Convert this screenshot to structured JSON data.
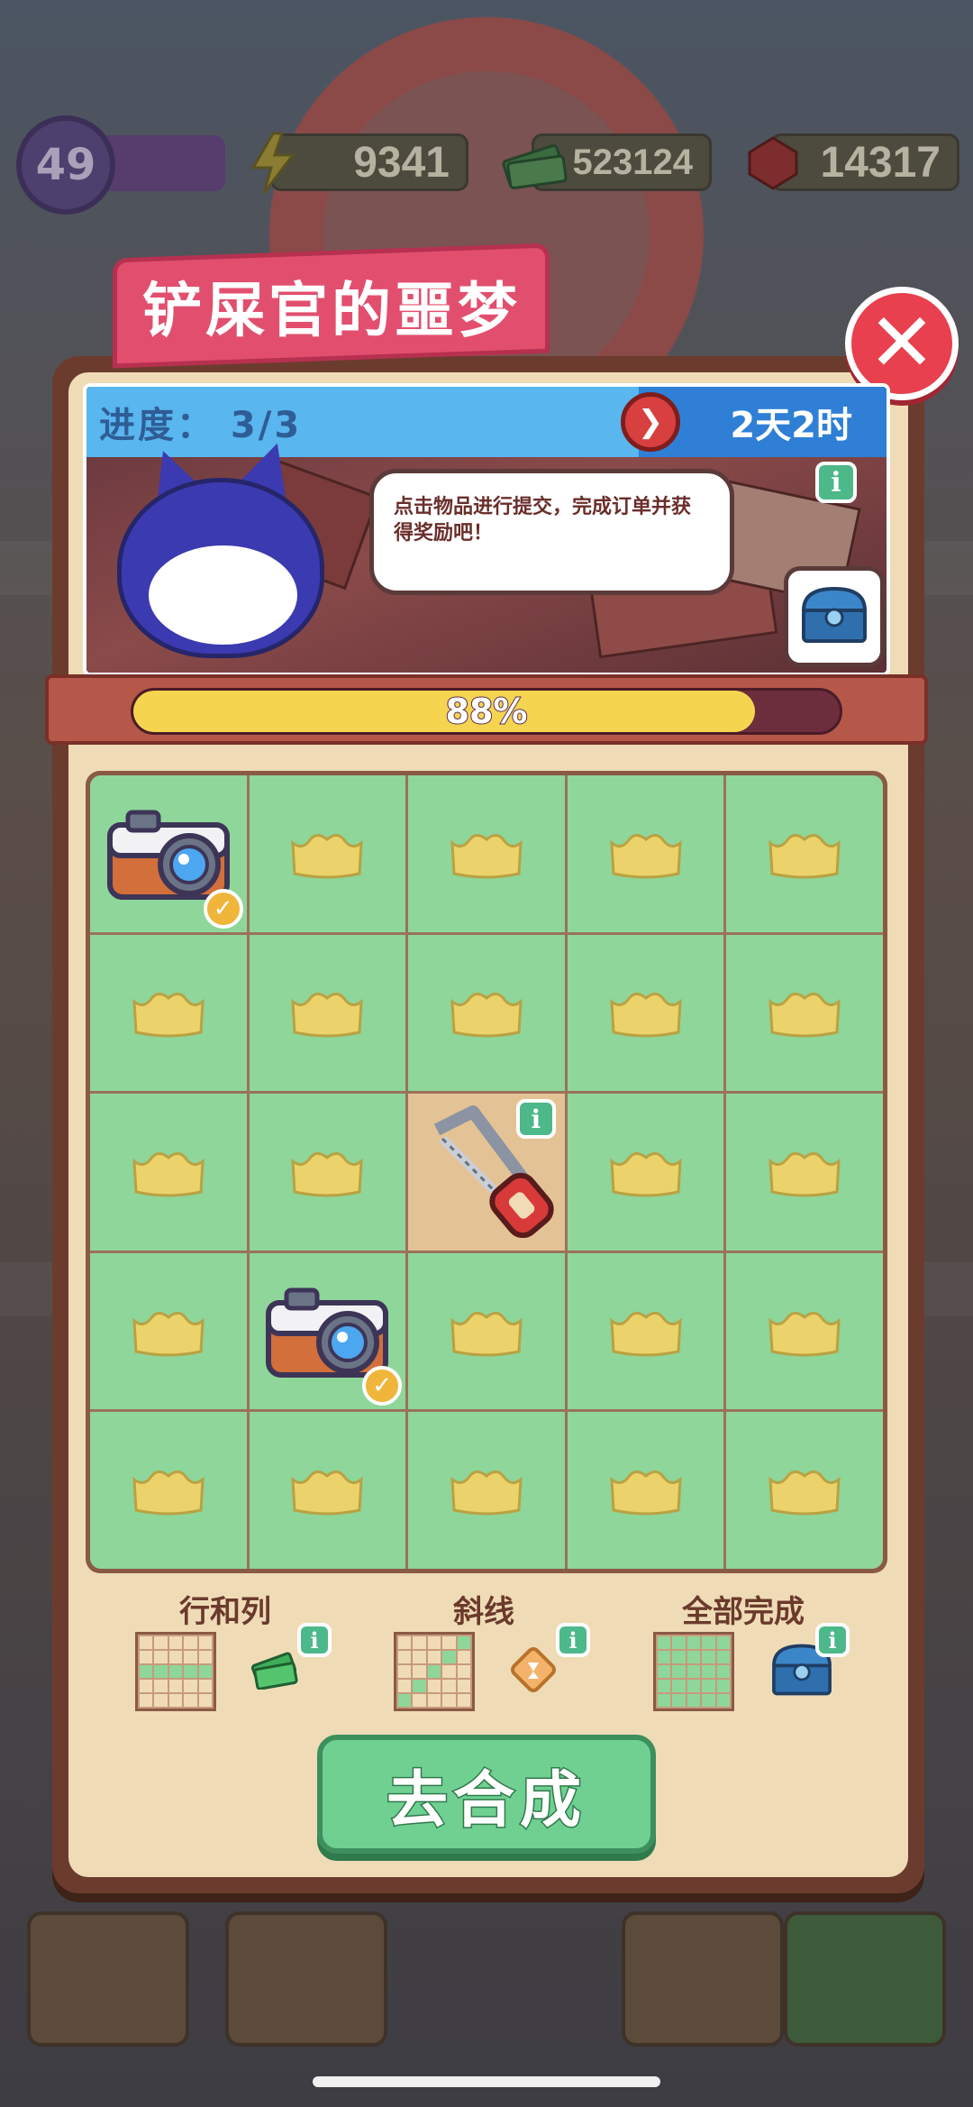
{
  "hud": {
    "level": "49",
    "energy": "9341",
    "cash": "523124",
    "gems": "14317"
  },
  "modal": {
    "title": "铲屎官的噩梦",
    "progress_label": "进度： 3/3",
    "timer": "2天2时",
    "speech": "点击物品进行提交，完成订单并获得奖励吧！",
    "progress_percent_text": "88%",
    "progress_fraction": 0.88,
    "close_icon": "close-icon",
    "go_button": "去合成"
  },
  "board": {
    "rows": 5,
    "cols": 5,
    "cells": [
      [
        "camera-done",
        "crown",
        "crown",
        "crown",
        "crown"
      ],
      [
        "crown",
        "crown",
        "crown",
        "crown",
        "crown"
      ],
      [
        "crown",
        "crown",
        "saw",
        "crown",
        "crown"
      ],
      [
        "crown",
        "camera-done",
        "crown",
        "crown",
        "crown"
      ],
      [
        "crown",
        "crown",
        "crown",
        "crown",
        "crown"
      ]
    ]
  },
  "rewards": [
    {
      "label": "行和列",
      "icon": "cash-icon"
    },
    {
      "label": "斜线",
      "icon": "coupon-icon"
    },
    {
      "label": "全部完成",
      "icon": "chest-icon"
    }
  ],
  "colors": {
    "accent_pink": "#e24f6e",
    "close_red": "#e8404e",
    "cell_green": "#8fd69a",
    "progress_yellow": "#f5d54f",
    "button_green": "#6fd092"
  }
}
